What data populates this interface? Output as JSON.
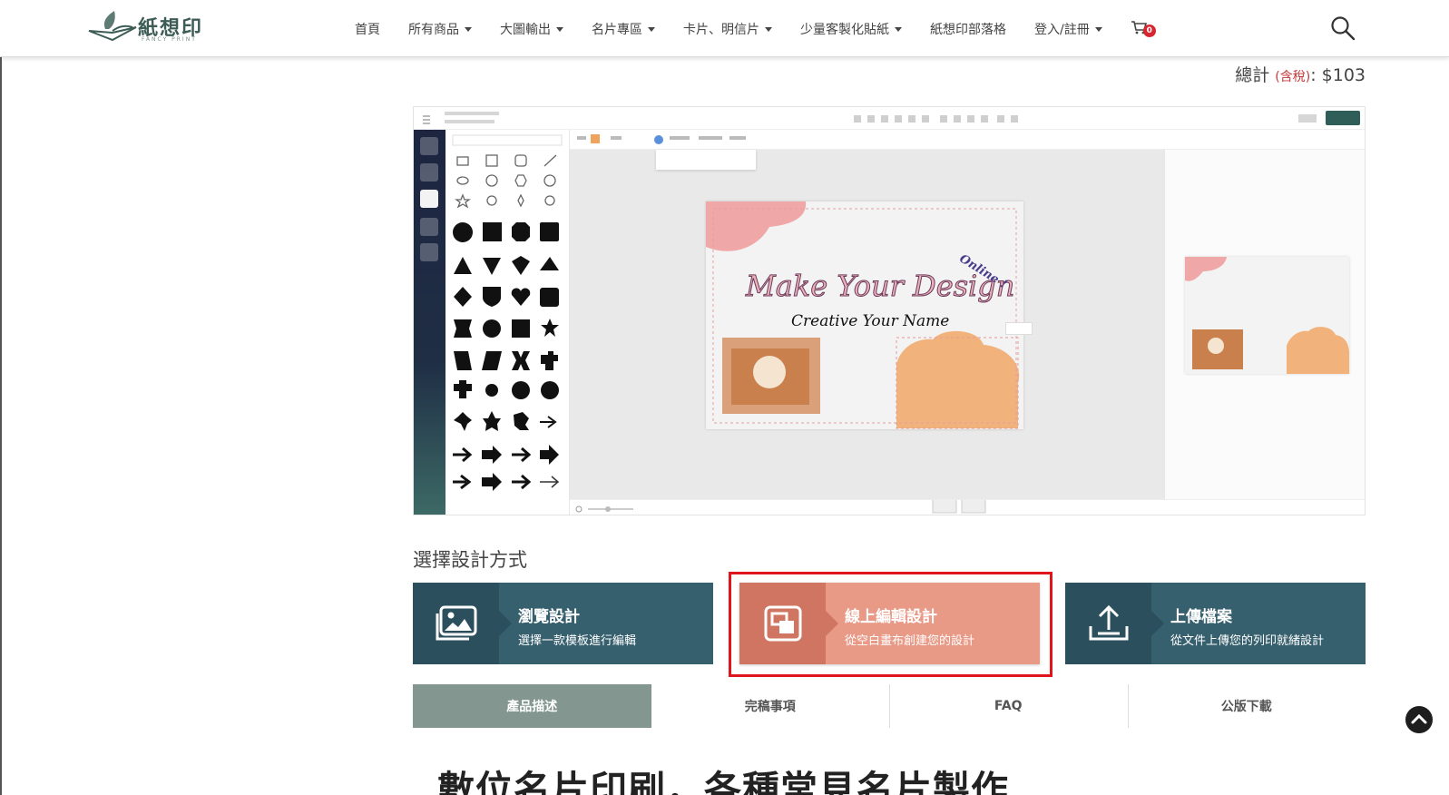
{
  "header": {
    "logo": {
      "name": "紙想印",
      "sub": "FANCY PRINT"
    },
    "nav": [
      {
        "label": "首頁",
        "dropdown": false
      },
      {
        "label": "所有商品",
        "dropdown": true
      },
      {
        "label": "大圖輸出",
        "dropdown": true
      },
      {
        "label": "名片專區",
        "dropdown": true
      },
      {
        "label": "卡片、明信片",
        "dropdown": true
      },
      {
        "label": "少量客製化貼紙",
        "dropdown": true
      },
      {
        "label": "紙想印部落格",
        "dropdown": false
      },
      {
        "label": "登入/註冊",
        "dropdown": true
      }
    ],
    "cart_count": "0",
    "icons": {
      "cart": "cart-icon",
      "search": "search-icon"
    }
  },
  "total": {
    "label": "總計",
    "tax": "(含稅)",
    "colon": ":",
    "amount": "$103"
  },
  "preview": {
    "headline": "Make Your Design",
    "online": "Online !",
    "subline": "Creative Your Name"
  },
  "design": {
    "section_title": "選擇設計方式",
    "options": [
      {
        "title": "瀏覽設計",
        "subtitle": "選擇一款模板進行編輯",
        "icon": "image-gallery-icon",
        "highlighted": false
      },
      {
        "title": "線上編輯設計",
        "subtitle": "從空白畫布創建您的設計",
        "icon": "canvas-edit-icon",
        "highlighted": true
      },
      {
        "title": "上傳檔案",
        "subtitle": "從文件上傳您的列印就緒設計",
        "icon": "upload-icon",
        "highlighted": false
      }
    ]
  },
  "tabs": [
    {
      "label": "產品描述",
      "active": true
    },
    {
      "label": "完稿事項",
      "active": false
    },
    {
      "label": "FAQ",
      "active": false
    },
    {
      "label": "公版下載",
      "active": false
    }
  ],
  "content": {
    "headline": "數位名片印刷，各種常見名片製作"
  },
  "colors": {
    "teal": "#37606e",
    "salmon": "#e99a87",
    "highlight_border": "#e0141c",
    "tab_active": "#83968f"
  }
}
